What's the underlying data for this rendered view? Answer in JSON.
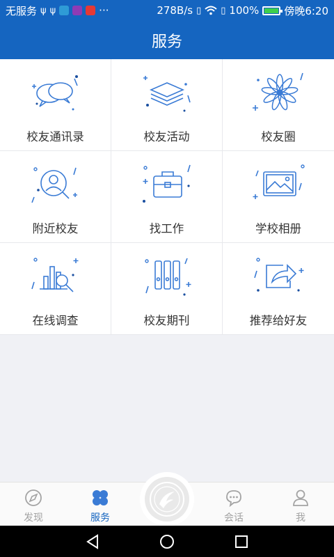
{
  "status_bar": {
    "carrier": "无服务",
    "speed": "278B/s",
    "battery_percent": "100%",
    "time": "傍晚6:20",
    "more": "···"
  },
  "header": {
    "title": "服务"
  },
  "grid": {
    "items": [
      {
        "label": "校友通讯录",
        "icon": "chat-bubbles-icon"
      },
      {
        "label": "校友活动",
        "icon": "layers-icon"
      },
      {
        "label": "校友圈",
        "icon": "flower-icon"
      },
      {
        "label": "附近校友",
        "icon": "person-search-icon"
      },
      {
        "label": "找工作",
        "icon": "briefcase-icon"
      },
      {
        "label": "学校相册",
        "icon": "picture-icon"
      },
      {
        "label": "在线调查",
        "icon": "chart-search-icon"
      },
      {
        "label": "校友期刊",
        "icon": "binders-icon"
      },
      {
        "label": "推荐给好友",
        "icon": "share-icon"
      }
    ]
  },
  "bottom_nav": {
    "items": [
      {
        "label": "发现",
        "icon": "compass-icon",
        "active": false
      },
      {
        "label": "服务",
        "icon": "grid-icon",
        "active": true
      },
      {
        "label": "会话",
        "icon": "chat-icon",
        "active": false
      },
      {
        "label": "我",
        "icon": "person-icon",
        "active": false
      }
    ],
    "center_icon": "school-logo-icon"
  },
  "colors": {
    "primary": "#1565c0",
    "icon_blue": "#3a7bd5",
    "text": "#333333",
    "inactive": "#a3a3a3"
  }
}
